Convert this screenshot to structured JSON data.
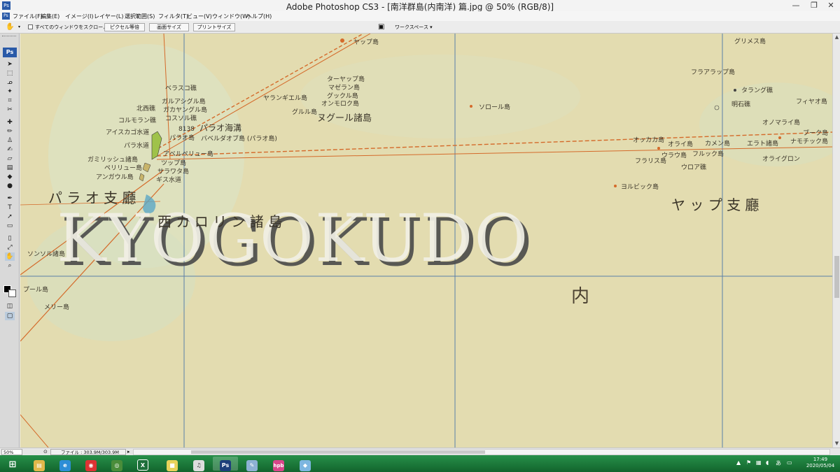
{
  "window": {
    "title": "Adobe Photoshop CS3 - [南洋群島(内南洋) 篇.jpg @ 50% (RGB/8)]",
    "minimize": "—",
    "restore": "❐",
    "close": "✕",
    "app_icon": "Ps"
  },
  "menu": [
    "ファイル(F)",
    "編集(E)",
    "イメージ(I)",
    "レイヤー(L)",
    "選択範囲(S)",
    "フィルタ(T)",
    "ビュー(V)",
    "ウィンドウ(W)",
    "ヘルプ(H)"
  ],
  "options": {
    "scroll_all": "すべてのウィンドウをスクロール",
    "actual_pixels": "ピクセル等倍",
    "fit_screen": "画面サイズ",
    "print_size": "プリントサイズ",
    "workspace": "ワークスペース ▾"
  },
  "toolbox": {
    "badge": "Ps",
    "tools": [
      "move-icon",
      "marquee-icon",
      "lasso-icon",
      "magic-wand-icon",
      "crop-icon",
      "slice-icon",
      "healing-icon",
      "brush-icon",
      "stamp-icon",
      "history-brush-icon",
      "eraser-icon",
      "gradient-icon",
      "blur-icon",
      "dodge-icon",
      "pen-icon",
      "type-icon",
      "path-select-icon",
      "shape-icon",
      "notes-icon",
      "eyedropper-icon",
      "hand-icon",
      "zoom-icon"
    ]
  },
  "map": {
    "watermark": "KYOGOKUDO",
    "labels": {
      "grimes": "グリメス島",
      "fraarap": "フラアラップ島",
      "tarang": "タラング礁",
      "fayao": "フィヤオ島",
      "myoseki": "明石礁",
      "onomarai": "オノマライ島",
      "bukku": "ブーク島",
      "namochik": "ナモチック島",
      "eraato": "エラト諸島",
      "oraigron": "オライグロン",
      "okkaka": "オッカカ島",
      "orai": "オライ島",
      "kamen": "カメン島",
      "furaris": "フラリス島",
      "urau": "ウラウ島",
      "fururukk": "フルック島",
      "urao": "ウロア礁",
      "yolbik": "ヨルビック島",
      "sororu": "ソロール島",
      "nugur": "ヌグール諸島",
      "targap": "ターヤップ島",
      "mazeran": "マゼラン島",
      "gukkuru": "グックル島",
      "onmorok": "オンモロク島",
      "gururu": "グルル島",
      "yarangi": "ヤランギエル島",
      "jappa": "ヤップ島",
      "verasu": "ベラスコ礁",
      "kitanishi": "北西礁",
      "garuasangu": "ガルアシグル島",
      "gakayanguru": "ガカヤングル島",
      "kosuru": "コスソル礁",
      "korumoran": "コルモラン礁",
      "aiisuka": "アイスカゴ水道",
      "paraowater": "パラオ海溝",
      "depth": "8138",
      "parao": "パラオ島",
      "baberudaob": "バベルダオブ島 (パラオ島)",
      "parawater": "パラ水道",
      "garamiruja": "ガミリッシュ諸島",
      "periryu": "ペリリュー島",
      "angaur": "アンガウル島",
      "kigasu": "ギス水道",
      "sonsoru": "ソンソル諸島",
      "puru": "プール島",
      "meri": "メリー島",
      "sarawaku": "サラワタ島",
      "sitanabe": "アベルペリュー島",
      "tsupa": "ツップ島",
      "region_parao": "パ ラ オ 支 廳",
      "region_west": "西  カ  ロ  リ  ン  諸  島",
      "region_yap": "ヤ ッ プ 支 廳",
      "naimain": "内"
    }
  },
  "status": {
    "zoom": "50%",
    "file": "ファイル : 303.9M/303.9M"
  },
  "taskbar": {
    "apps": [
      {
        "name": "start-icon",
        "label": "⊞"
      },
      {
        "name": "file-explorer-icon",
        "label": "▤"
      },
      {
        "name": "ie-icon",
        "label": "e"
      },
      {
        "name": "chrome-icon",
        "label": "◉"
      },
      {
        "name": "chrome-alt-icon",
        "label": "◎"
      },
      {
        "name": "excel-icon",
        "label": "X"
      },
      {
        "name": "folder-icon",
        "label": "■"
      },
      {
        "name": "itunes-icon",
        "label": "♫"
      },
      {
        "name": "photoshop-icon",
        "label": "Ps"
      },
      {
        "name": "paint-icon",
        "label": "✎"
      },
      {
        "name": "hpb-icon",
        "label": "hpb"
      },
      {
        "name": "misc-icon",
        "label": "◆"
      }
    ],
    "time": "17:49",
    "date": "2020/05/04"
  },
  "colors": {
    "map_bg": "#e5ddae",
    "route_red": "#d46a2a",
    "grid_blue": "#5a7fa8"
  }
}
